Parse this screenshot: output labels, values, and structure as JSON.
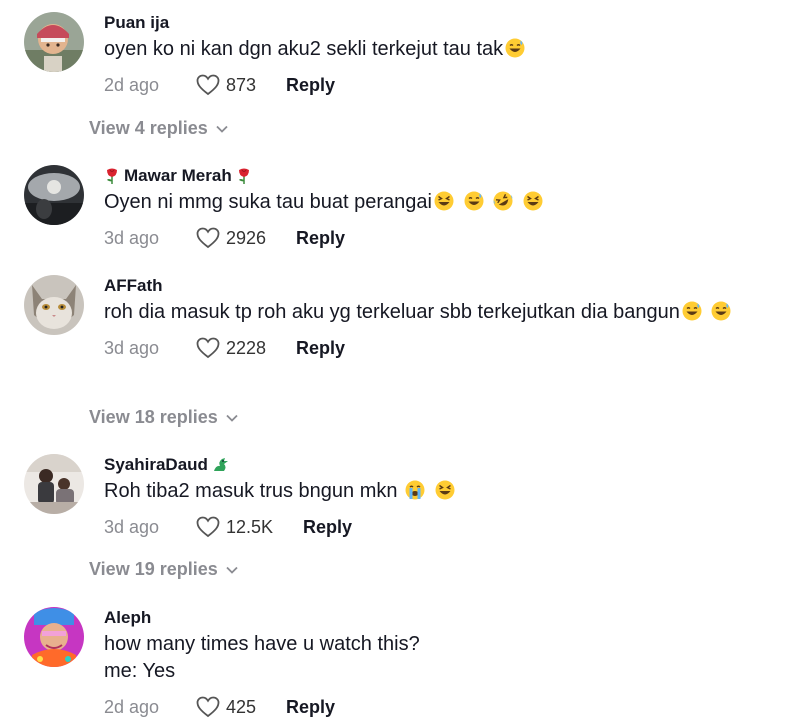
{
  "comments": [
    {
      "username": "Puan ija",
      "text": "oyen ko ni kan dgn aku2 sekli terkejut tau tak",
      "emojis": [
        "sweat-grin"
      ],
      "time": "2d ago",
      "likes": "873",
      "reply_label": "Reply",
      "view_replies": "View 4 replies"
    },
    {
      "username": "Mawar Merah",
      "text": "Oyen ni mmg suka tau buat perangai",
      "emojis": [
        "squint-laugh",
        "sweat-grin",
        "rofl",
        "squint-laugh"
      ],
      "time": "3d ago",
      "likes": "2926",
      "reply_label": "Reply"
    },
    {
      "username": "AFFath",
      "text": "roh dia masuk tp roh aku yg terkeluar sbb terkejutkan dia bangun",
      "emojis": [
        "sweat-grin",
        "sweat-grin"
      ],
      "time": "3d ago",
      "likes": "2228",
      "reply_label": "Reply",
      "view_replies": "View 18 replies"
    },
    {
      "username": "SyahiraDaud",
      "text": "Roh tiba2 masuk trus bngun mkn",
      "emojis": [
        "crying",
        "squint-laugh"
      ],
      "time": "3d ago",
      "likes": "12.5K",
      "reply_label": "Reply",
      "view_replies": "View 19 replies"
    },
    {
      "username": "Aleph",
      "text": "how many times have u watch this?\nme: Yes",
      "emojis": [],
      "time": "2d ago",
      "likes": "425",
      "reply_label": "Reply"
    }
  ],
  "colors": {
    "text": "#161823",
    "muted": "#8a8b91",
    "emoji_face": "#ffcc33"
  }
}
